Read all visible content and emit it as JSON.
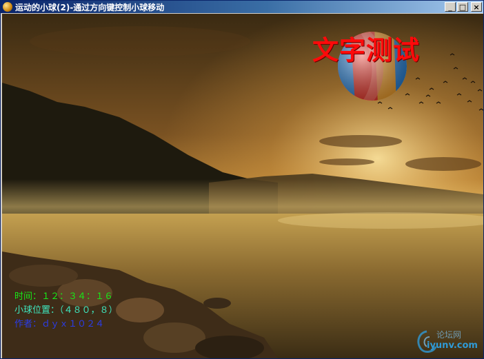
{
  "window": {
    "title": "运动的小球(2)-通过方向键控制小球移动",
    "controls": {
      "minimize": "_",
      "maximize": "□",
      "close": "×"
    }
  },
  "game": {
    "overlay_title": "文字测试",
    "time_line": "时间：１２：３４：１６",
    "ball_position_line": "小球位置：（４８０，８）",
    "author_line": "作者：ｄｙｘ１０２４",
    "ball_colors": [
      "#e8352a",
      "#2a82d6",
      "#f0a030",
      "#f2f2f2"
    ],
    "watermark": {
      "top": "论坛网",
      "bottom": "iyunv.com"
    }
  },
  "colors": {
    "title_red": "#ff0a0a",
    "hud_green": "#18e818",
    "hud_cyan": "#3ee8c0",
    "hud_blue": "#2a3ce8"
  }
}
